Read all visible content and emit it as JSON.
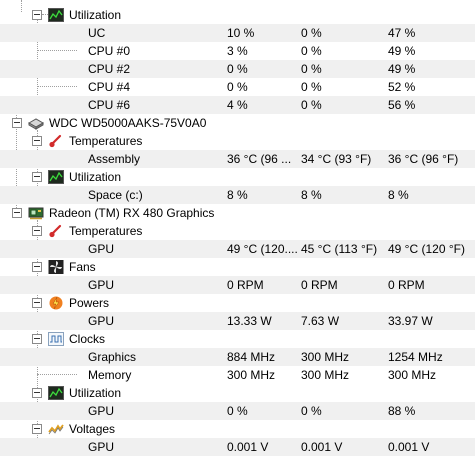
{
  "tree": {
    "row_top_partial": {
      "label": "",
      "v1": "",
      "v2": "",
      "v3": ""
    },
    "cpu_utilization": {
      "header": "Utilization",
      "icon": "utilization-chart-icon",
      "items": [
        {
          "label": "UC",
          "value": "10 %",
          "min": "0 %",
          "max": "47 %"
        },
        {
          "label": "CPU #0",
          "value": "3 %",
          "min": "0 %",
          "max": "49 %"
        },
        {
          "label": "CPU #2",
          "value": "0 %",
          "min": "0 %",
          "max": "49 %"
        },
        {
          "label": "CPU #4",
          "value": "0 %",
          "min": "0 %",
          "max": "52 %"
        },
        {
          "label": "CPU #6",
          "value": "4 %",
          "min": "0 %",
          "max": "56 %"
        }
      ]
    },
    "disk": {
      "name": "WDC WD5000AAKS-75V0A0",
      "icon": "hard-disk-icon",
      "temperatures": {
        "header": "Temperatures",
        "icon": "thermometer-icon",
        "items": [
          {
            "label": "Assembly",
            "value": "36 °C  (96 ...",
            "min": "34 °C  (93 °F)",
            "max": "36 °C  (96 °F)"
          }
        ]
      },
      "utilization": {
        "header": "Utilization",
        "icon": "utilization-chart-icon",
        "items": [
          {
            "label": "Space (c:)",
            "value": "8 %",
            "min": "8 %",
            "max": "8 %"
          }
        ]
      }
    },
    "gpu": {
      "name": "Radeon (TM) RX 480 Graphics",
      "icon": "graphics-card-icon",
      "temperatures": {
        "header": "Temperatures",
        "icon": "thermometer-icon",
        "items": [
          {
            "label": "GPU",
            "value": "49 °C  (120....",
            "min": "45 °C  (113 °F)",
            "max": "49 °C  (120 °F)"
          }
        ]
      },
      "fans": {
        "header": "Fans",
        "icon": "fan-icon",
        "items": [
          {
            "label": "GPU",
            "value": "0 RPM",
            "min": "0 RPM",
            "max": "0 RPM"
          }
        ]
      },
      "powers": {
        "header": "Powers",
        "icon": "power-flame-icon",
        "items": [
          {
            "label": "GPU",
            "value": "13.33 W",
            "min": "7.63 W",
            "max": "33.97 W"
          }
        ]
      },
      "clocks": {
        "header": "Clocks",
        "icon": "clock-wave-icon",
        "items": [
          {
            "label": "Graphics",
            "value": "884 MHz",
            "min": "300 MHz",
            "max": "1254 MHz"
          },
          {
            "label": "Memory",
            "value": "300 MHz",
            "min": "300 MHz",
            "max": "300 MHz"
          }
        ]
      },
      "utilization": {
        "header": "Utilization",
        "icon": "utilization-chart-icon",
        "items": [
          {
            "label": "GPU",
            "value": "0 %",
            "min": "0 %",
            "max": "88 %"
          }
        ]
      },
      "voltages": {
        "header": "Voltages",
        "icon": "voltage-wave-icon",
        "items": [
          {
            "label": "GPU",
            "value": "0.001 V",
            "min": "0.001 V",
            "max": "0.001 V"
          }
        ]
      }
    }
  },
  "colors": {
    "row_alt": "#f0f0f0",
    "tree_line": "#a0a0a0",
    "thermometer_red": "#d22b2b",
    "chart_green": "#1a8a1a",
    "flame_orange": "#f08020"
  }
}
